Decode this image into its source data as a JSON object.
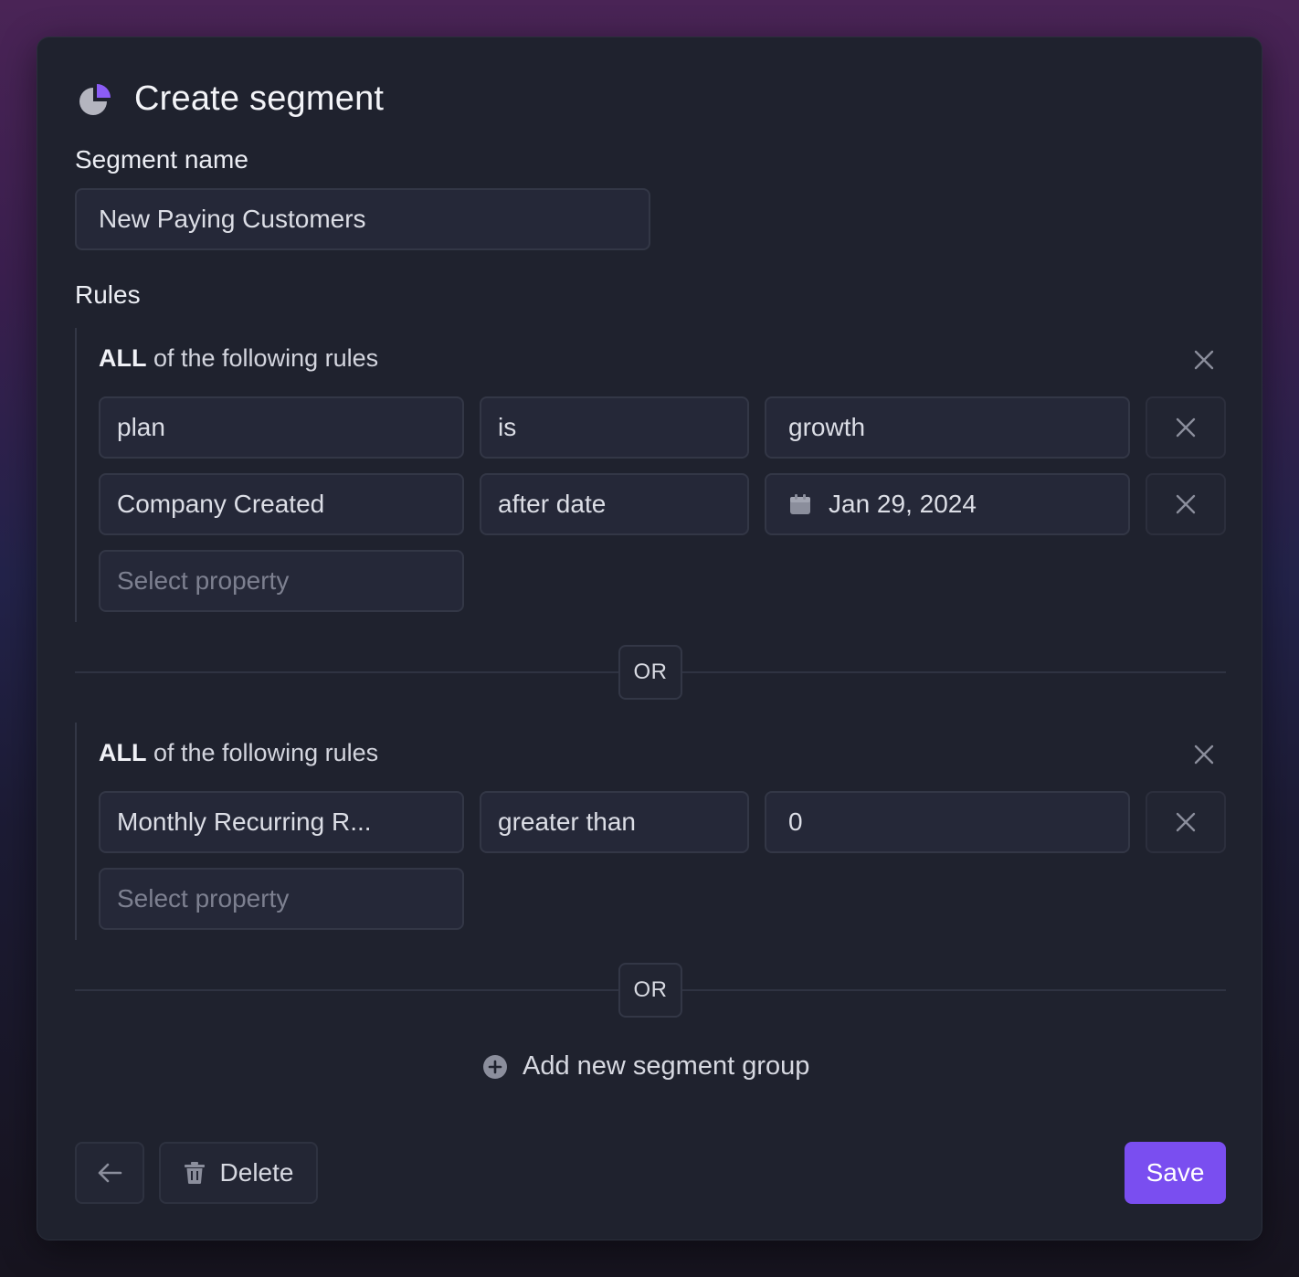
{
  "dialog": {
    "title": "Create segment",
    "name_label": "Segment name",
    "name_value": "New Paying Customers",
    "rules_label": "Rules"
  },
  "groups": [
    {
      "title_bold": "ALL",
      "title_rest": " of the following rules",
      "rules": [
        {
          "property": "plan",
          "operator": "is",
          "value": "growth"
        },
        {
          "property": "Company Created",
          "operator": "after date",
          "value": "Jan 29, 2024"
        }
      ],
      "add_placeholder": "Select property"
    },
    {
      "title_bold": "ALL",
      "title_rest": " of the following rules",
      "rules": [
        {
          "property": "Monthly Recurring R...",
          "operator": "greater than",
          "value": "0"
        }
      ],
      "add_placeholder": "Select property"
    }
  ],
  "separator_label": "OR",
  "add_group_label": "Add new segment group",
  "footer": {
    "delete_label": "Delete",
    "save_label": "Save"
  },
  "colors": {
    "accent": "#7a4ef0",
    "card_bg": "#1f222e"
  }
}
